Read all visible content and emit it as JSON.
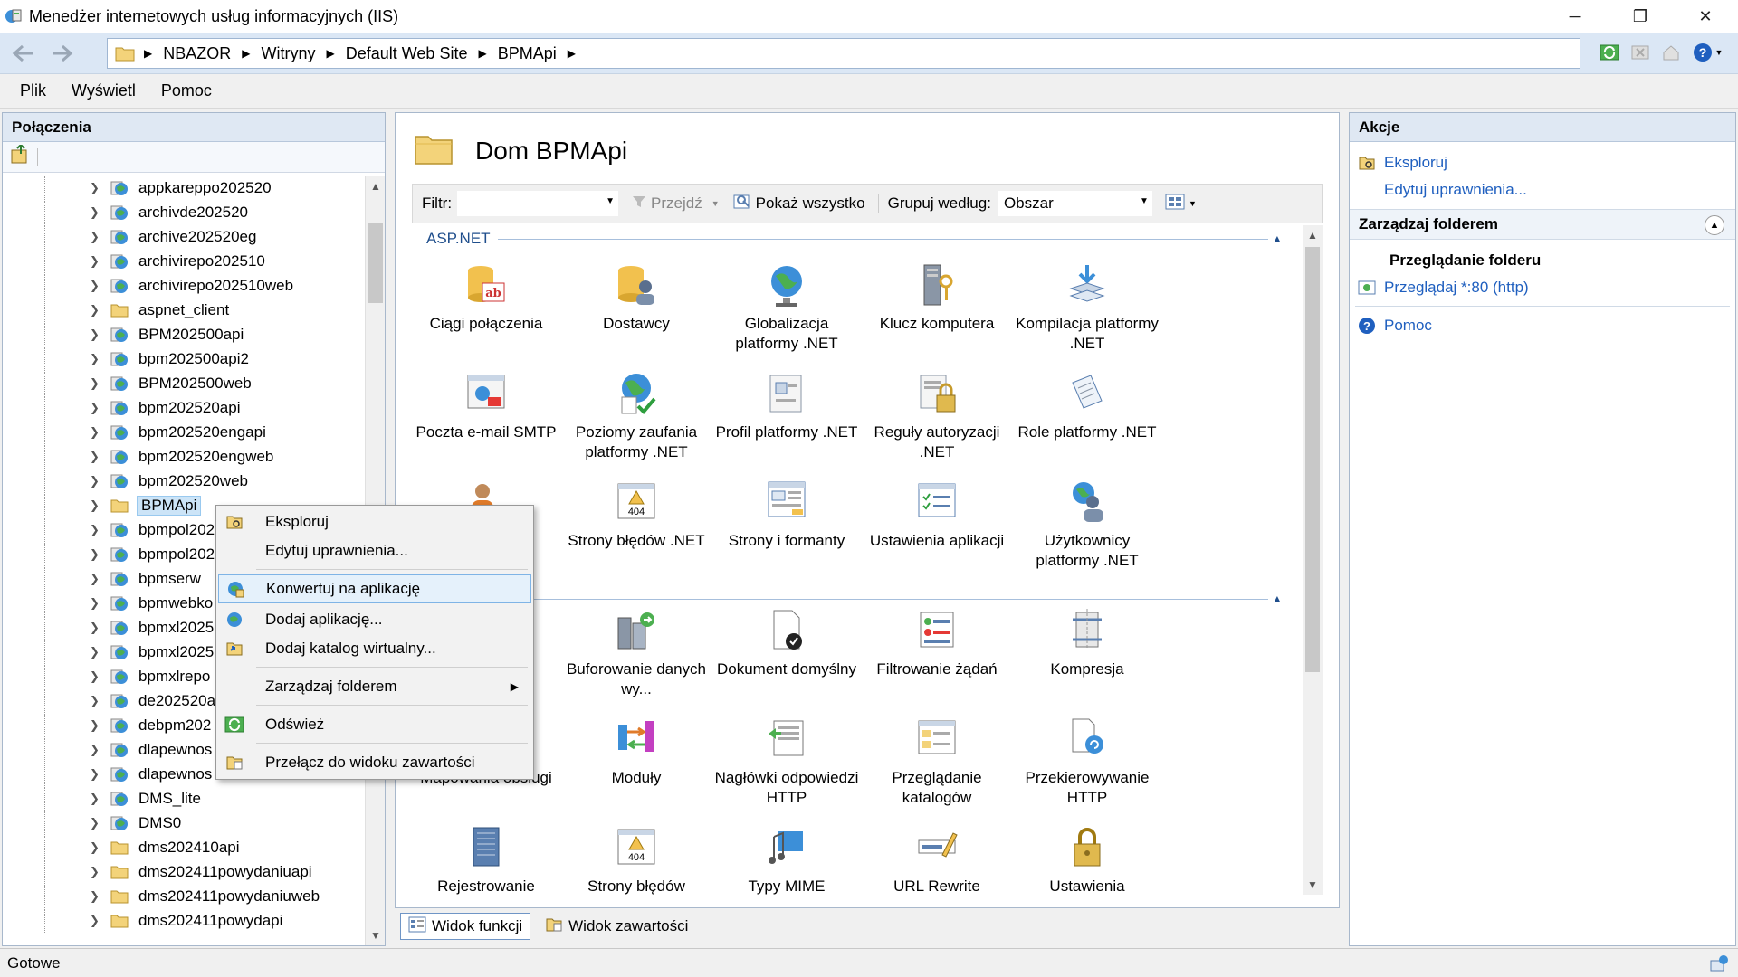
{
  "window": {
    "title": "Menedżer internetowych usług informacyjnych (IIS)",
    "minimize": "─",
    "restore": "❐",
    "close": "✕"
  },
  "address": {
    "crumbs": [
      "NBAZOR",
      "Witryny",
      "Default Web Site",
      "BPMApi"
    ]
  },
  "menu": [
    "Plik",
    "Wyświetl",
    "Pomoc"
  ],
  "connections": {
    "header": "Połączenia",
    "items": [
      {
        "label": "appkareppo202520",
        "icon": "web-app-icon"
      },
      {
        "label": "archivde202520",
        "icon": "web-app-icon"
      },
      {
        "label": "archive202520eg",
        "icon": "web-app-icon"
      },
      {
        "label": "archivirepo202510",
        "icon": "web-app-icon"
      },
      {
        "label": "archivirepo202510web",
        "icon": "web-app-icon"
      },
      {
        "label": "aspnet_client",
        "icon": "folder-icon"
      },
      {
        "label": "BPM202500api",
        "icon": "web-app-icon"
      },
      {
        "label": "bpm202500api2",
        "icon": "web-app-icon"
      },
      {
        "label": "BPM202500web",
        "icon": "web-app-icon"
      },
      {
        "label": "bpm202520api",
        "icon": "web-app-icon"
      },
      {
        "label": "bpm202520engapi",
        "icon": "web-app-icon"
      },
      {
        "label": "bpm202520engweb",
        "icon": "web-app-icon"
      },
      {
        "label": "bpm202520web",
        "icon": "web-app-icon"
      },
      {
        "label": "BPMApi",
        "icon": "folder-icon",
        "selected": true
      },
      {
        "label": "bpmpol202",
        "icon": "web-app-icon"
      },
      {
        "label": "bpmpol202",
        "icon": "web-app-icon"
      },
      {
        "label": "bpmserw",
        "icon": "web-app-icon"
      },
      {
        "label": "bpmwebko",
        "icon": "web-app-icon"
      },
      {
        "label": "bpmxl2025",
        "icon": "web-app-icon"
      },
      {
        "label": "bpmxl2025",
        "icon": "web-app-icon"
      },
      {
        "label": "bpmxlrepo",
        "icon": "web-app-icon"
      },
      {
        "label": "de202520ap",
        "icon": "web-app-icon"
      },
      {
        "label": "debpm202",
        "icon": "web-app-icon"
      },
      {
        "label": "dlapewnos",
        "icon": "web-app-icon"
      },
      {
        "label": "dlapewnos",
        "icon": "web-app-icon"
      },
      {
        "label": "DMS_lite",
        "icon": "web-app-icon"
      },
      {
        "label": "DMS0",
        "icon": "web-app-icon"
      },
      {
        "label": "dms202410api",
        "icon": "folder-icon"
      },
      {
        "label": "dms202411powydaniuapi",
        "icon": "folder-icon"
      },
      {
        "label": "dms202411powydaniuweb",
        "icon": "folder-icon"
      },
      {
        "label": "dms202411powydapi",
        "icon": "folder-icon"
      }
    ]
  },
  "center": {
    "title": "Dom BPMApi",
    "filter_label": "Filtr:",
    "go_label": "Przejdź",
    "show_all_label": "Pokaż wszystko",
    "group_label": "Grupuj według:",
    "group_value": "Obszar",
    "section_aspnet": "ASP.NET",
    "features_row1": [
      "Ciągi połączenia",
      "Dostawcy",
      "Globalizacja platformy .NET",
      "Klucz komputera",
      "Kompilacja platformy .NET"
    ],
    "features_row2": [
      "Poczta e-mail SMTP",
      "Poziomy zaufania platformy .NET",
      "Profil platformy .NET",
      "Reguły autoryzacji .NET",
      "Role platformy .NET"
    ],
    "features_row3": [
      "Strony błędów .NET",
      "Strony i formanty",
      "Ustawienia aplikacji",
      "Użytkownicy platformy .NET"
    ],
    "features_row4": [
      "Buforowanie danych wy...",
      "Dokument domyślny",
      "Filtrowanie żądań",
      "Kompresja"
    ],
    "features_row5_first": "Mapowania obsługi",
    "features_row5": [
      "Moduły",
      "Nagłówki odpowiedzi HTTP",
      "Przeglądanie katalogów",
      "Przekierowywanie HTTP"
    ],
    "features_row6": [
      "Rejestrowanie",
      "Strony błędów",
      "Typy MIME",
      "URL Rewrite",
      "Ustawienia"
    ]
  },
  "viewtabs": {
    "features": "Widok funkcji",
    "content": "Widok zawartości"
  },
  "actions": {
    "header": "Akcje",
    "explore": "Eksploruj",
    "edit_permissions": "Edytuj uprawnienia...",
    "manage_folder": "Zarządzaj folderem",
    "browse_folder": "Przeglądanie folderu",
    "browse_link": "Przeglądaj *:80 (http)",
    "help": "Pomoc"
  },
  "context_menu": {
    "explore": "Eksploruj",
    "edit_permissions": "Edytuj uprawnienia...",
    "convert_app": "Konwertuj na aplikację",
    "add_app": "Dodaj aplikację...",
    "add_vdir": "Dodaj katalog wirtualny...",
    "manage_folder": "Zarządzaj folderem",
    "refresh": "Odśwież",
    "switch_content": "Przełącz do widoku zawartości"
  },
  "status": {
    "text": "Gotowe"
  },
  "colors": {
    "link": "#1f5fbf",
    "section": "#1f4e8c",
    "highlight": "#e5f1fb"
  }
}
